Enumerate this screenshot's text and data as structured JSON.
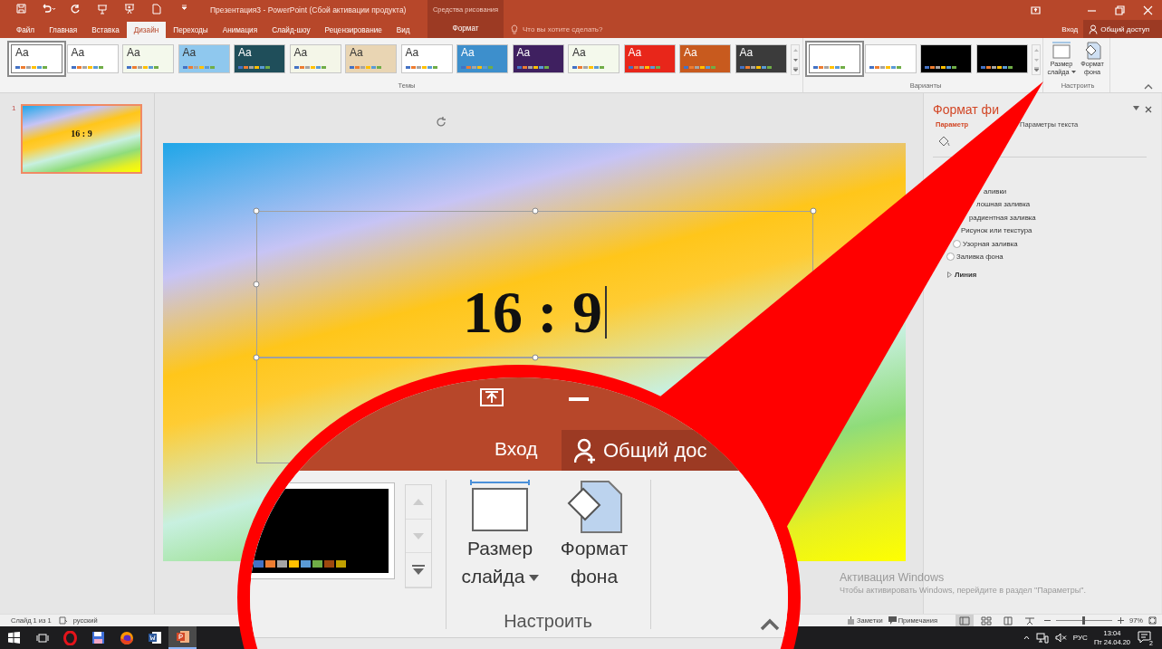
{
  "title_bar": {
    "title": "Презентация3 - PowerPoint (Сбой активации продукта)",
    "context_group": "Средства рисования"
  },
  "tabs": [
    {
      "label": "Файл",
      "kind": "normal",
      "selected": false
    },
    {
      "label": "Главная",
      "kind": "normal",
      "selected": false
    },
    {
      "label": "Вставка",
      "kind": "normal",
      "selected": false
    },
    {
      "label": "Дизайн",
      "kind": "normal",
      "selected": true
    },
    {
      "label": "Переходы",
      "kind": "normal",
      "selected": false
    },
    {
      "label": "Анимация",
      "kind": "normal",
      "selected": false
    },
    {
      "label": "Слайд-шоу",
      "kind": "normal",
      "selected": false
    },
    {
      "label": "Рецензирование",
      "kind": "normal",
      "selected": false
    },
    {
      "label": "Вид",
      "kind": "normal",
      "selected": false
    },
    {
      "label": "Формат",
      "kind": "context",
      "selected": false
    }
  ],
  "tell_me": {
    "placeholder": "Что вы хотите сделать?"
  },
  "account": {
    "sign_in": "Вход",
    "share": "Общий доступ"
  },
  "ribbon": {
    "themes": {
      "label": "Темы",
      "items": [
        {
          "text": "Aa",
          "color": "#ffffff",
          "selected": true
        },
        {
          "text": "Aa",
          "color": "#ffffff",
          "selected": false
        },
        {
          "text": "Aa",
          "color": "#f4f9ec",
          "selected": false
        },
        {
          "text": "Aa",
          "color": "#8fc8ee",
          "selected": false
        },
        {
          "text": "Aa",
          "color": "#1f4e5a",
          "selected": false
        },
        {
          "text": "Aa",
          "color": "#f4f6e8",
          "selected": false
        },
        {
          "text": "Aa",
          "color": "#e9d5b3",
          "selected": false
        },
        {
          "text": "Aa",
          "color": "#ffffff",
          "selected": false
        },
        {
          "text": "Aa",
          "color": "#3d8fcc",
          "selected": false
        },
        {
          "text": "Aa",
          "color": "#3f2060",
          "selected": false
        },
        {
          "text": "Aa",
          "color": "#f4f9ec",
          "selected": false
        },
        {
          "text": "Aa",
          "color": "#e8261a",
          "selected": false
        },
        {
          "text": "Aa",
          "color": "#c85a1e",
          "selected": false
        },
        {
          "text": "Aa",
          "color": "#3b3b3b",
          "selected": false
        }
      ]
    },
    "variants": {
      "label": "Варианты",
      "items": [
        {
          "color": "#ffffff",
          "selected": true
        },
        {
          "color": "#ffffff",
          "selected": false
        },
        {
          "color": "#000000",
          "selected": false
        },
        {
          "color": "#000000",
          "selected": false
        }
      ]
    },
    "customize": {
      "label": "Настроить",
      "buttons": [
        "Размер слайда",
        "Формат фона"
      ]
    }
  },
  "slides": [
    {
      "number": "1",
      "title": "16 : 9",
      "selected": true
    }
  ],
  "slide": {
    "title": "16 : 9"
  },
  "format_pane": {
    "title": "Формат фи",
    "tabs": [
      {
        "label": "Параметр",
        "selected": true
      },
      {
        "label": "Параметры текста",
        "selected": false
      }
    ],
    "fill_options": [
      {
        "kind": "text",
        "label": "аливки"
      },
      {
        "kind": "text",
        "label": "лошная заливка"
      },
      {
        "kind": "text",
        "label": "радиентная заливка"
      },
      {
        "kind": "text",
        "label": "Рисунок или текстура"
      },
      {
        "kind": "radio",
        "label": "Узорная заливка",
        "selected": false
      },
      {
        "kind": "radio",
        "label": "Заливка фона",
        "selected": false
      }
    ],
    "section": "Линия"
  },
  "activation": {
    "title": "Активация Windows",
    "message": "Чтобы активировать Windows, перейдите в раздел \"Параметры\"."
  },
  "status_bar": {
    "slide_info": "Слайд 1 из 1",
    "language": "русский",
    "notes": "Заметки",
    "comments": "Примечания",
    "views": [
      {
        "selected": true
      },
      {
        "selected": false
      },
      {
        "selected": false
      },
      {
        "selected": false
      }
    ],
    "zoom": {
      "level": 0.5,
      "reading": "97%"
    }
  },
  "taskbar": {
    "apps": [
      {
        "kind": "ring",
        "selected": false
      },
      {
        "kind": "floppy",
        "selected": false
      },
      {
        "kind": "globe",
        "selected": false
      },
      {
        "kind": "document",
        "selected": false
      },
      {
        "kind": "presentation",
        "selected": true
      }
    ],
    "language": "РУС",
    "time": "13:04",
    "date": "Пт 24.04.20",
    "notifications": "2"
  },
  "callout": {
    "sign_in": "Вход",
    "share": "Общий дос",
    "buttons": [
      "Размер слайда",
      "Формат фона"
    ],
    "group": "Настроить"
  }
}
